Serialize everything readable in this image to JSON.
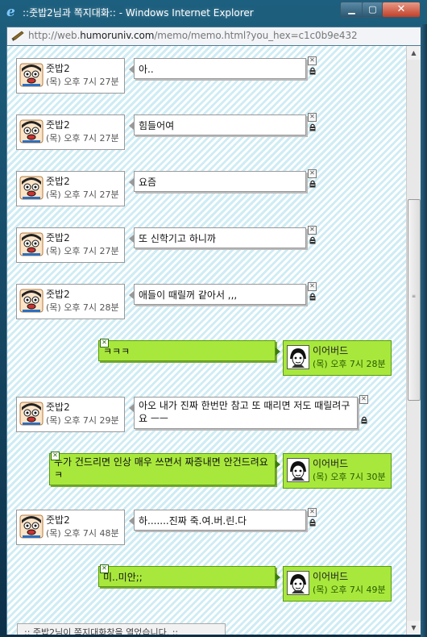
{
  "window": {
    "title": "::줏밥2님과 쪽지대화:: - Windows Internet Explorer",
    "url_prefix": "http://web.",
    "url_domain": "humoruniv.com",
    "url_path": "/memo/memo.html?you_hex=c1c0b9e432",
    "min_label": "▁",
    "max_label": "▢",
    "close_label": "✕"
  },
  "icons": {
    "x": "✕",
    "lock": "🔒",
    "scroll_up": "▲",
    "scroll_down": "▼",
    "grip": "≡"
  },
  "colors": {
    "mine_bubble": "#a8e83c",
    "their_bubble": "#ffffff",
    "background_stripe": "#cfecf4"
  },
  "messages": [
    {
      "sender": "줏밥2",
      "time": "(목) 오후 7시 27분",
      "text": "아..",
      "side": "left"
    },
    {
      "sender": "줏밥2",
      "time": "(목) 오후 7시 27분",
      "text": "힘들어여",
      "side": "left"
    },
    {
      "sender": "줏밥2",
      "time": "(목) 오후 7시 27분",
      "text": "요즘",
      "side": "left"
    },
    {
      "sender": "줏밥2",
      "time": "(목) 오후 7시 27분",
      "text": "또 신학기고 하니까",
      "side": "left"
    },
    {
      "sender": "줏밥2",
      "time": "(목) 오후 7시 28분",
      "text": "애들이 때릴꺼 같아서 ,,,",
      "side": "left"
    },
    {
      "sender": "이어버드",
      "time": "(목) 오후 7시 28분",
      "text": "ㅋㅋㅋ",
      "side": "right"
    },
    {
      "sender": "줏밥2",
      "time": "(목) 오후 7시 29분",
      "text": "아오 내가 진짜 한번만 참고 또 때리면 저도 때릴려구요 ㅡㅡ",
      "side": "left"
    },
    {
      "sender": "이어버드",
      "time": "(목) 오후 7시 30분",
      "text": "누가 건드리면 인상 매우 쓰면서 짜증내면 안건드려요 ㅋ",
      "side": "right"
    },
    {
      "sender": "줏밥2",
      "time": "(목) 오후 7시 48분",
      "text": "하.......진짜 죽.여.버.린.다",
      "side": "left"
    },
    {
      "sender": "이어버드",
      "time": "(목) 오후 7시 49분",
      "text": "미..미안;;",
      "side": "right"
    }
  ],
  "notice": "::  줏밥2님이 쪽지대화창을 열었습니다. ::"
}
